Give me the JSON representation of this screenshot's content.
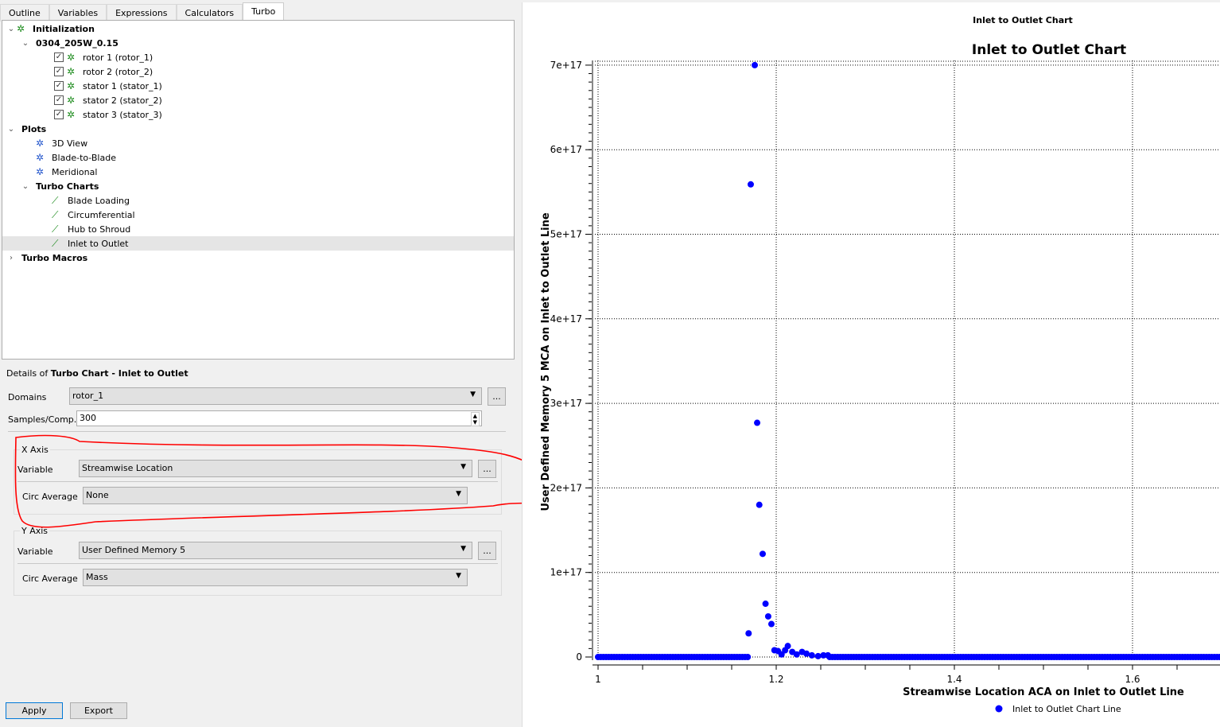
{
  "tabs": [
    "Outline",
    "Variables",
    "Expressions",
    "Calculators",
    "Turbo"
  ],
  "active_tab": "Turbo",
  "tree": {
    "initialization": "Initialization",
    "case": "0304_205W_0.15",
    "components": [
      "rotor 1 (rotor_1)",
      "rotor 2 (rotor_2)",
      "stator 1 (stator_1)",
      "stator 2 (stator_2)",
      "stator 3 (stator_3)"
    ],
    "plots": "Plots",
    "plot_items": [
      "3D View",
      "Blade-to-Blade",
      "Meridional"
    ],
    "turbo_charts": "Turbo Charts",
    "chart_items": [
      "Blade Loading",
      "Circumferential",
      "Hub to Shroud",
      "Inlet to Outlet"
    ],
    "selected": "Inlet to Outlet",
    "turbo_macros": "Turbo Macros"
  },
  "details": {
    "prefix": "Details of ",
    "title": "Turbo Chart - Inlet to Outlet",
    "domains_label": "Domains",
    "domains_value": "rotor_1",
    "samples_label": "Samples/Comp.",
    "samples_value": "300",
    "x_axis": {
      "title": "X Axis",
      "variable_label": "Variable",
      "variable": "Streamwise Location",
      "circ_label": "Circ Average",
      "circ": "None"
    },
    "y_axis": {
      "title": "Y Axis",
      "variable_label": "Variable",
      "variable": "User Defined Memory 5",
      "circ_label": "Circ Average",
      "circ": "Mass"
    },
    "dots": "...",
    "apply": "Apply",
    "export": "Export"
  },
  "annotation_color": "#ff0000",
  "chart_data": {
    "type": "scatter",
    "window_title": "Inlet to Outlet Chart",
    "title": "Inlet to Outlet Chart",
    "xlabel": "Streamwise Location ACA on Inlet to Outlet Line",
    "ylabel": "User Defined Memory 5 MCA on Inlet to Outlet Line",
    "xlim": [
      1.0,
      1.7
    ],
    "ylim": [
      0,
      7e+17
    ],
    "xticks": [
      1,
      1.2,
      1.4,
      1.6
    ],
    "xtick_labels": [
      "1",
      "1.2",
      "1.4",
      "1.6"
    ],
    "yticks": [
      0,
      1e+17,
      2e+17,
      3e+17,
      4e+17,
      5e+17,
      6e+17,
      7e+17
    ],
    "ytick_labels": [
      "0",
      "1e+17",
      "2e+17",
      "3e+17",
      "4e+17",
      "5e+17",
      "6e+17",
      "7e+17"
    ],
    "grid": true,
    "legend": {
      "position": "bottom",
      "label": "Inlet to Outlet Chart Line"
    },
    "color": "#0000ff",
    "baseline_segments": [
      [
        1.0,
        1.168,
        0
      ],
      [
        1.26,
        1.7,
        0
      ]
    ],
    "baseline_step": 0.003,
    "points": [
      [
        1.169,
        2.8e+16
      ],
      [
        1.1714,
        5.59e+17
      ],
      [
        1.1759,
        7e+17
      ],
      [
        1.1786,
        2.77e+17
      ],
      [
        1.181,
        1.8e+17
      ],
      [
        1.1848,
        1.22e+17
      ],
      [
        1.188,
        6.3e+16
      ],
      [
        1.191,
        4.8e+16
      ],
      [
        1.1946,
        3.9e+16
      ],
      [
        1.198,
        8000000000000000.0
      ],
      [
        1.202,
        7000000000000000.0
      ],
      [
        1.206,
        3000000000000000.0
      ],
      [
        1.21,
        8000000000000000.0
      ],
      [
        1.213,
        1.3e+16
      ],
      [
        1.218,
        6000000000000000.0
      ],
      [
        1.223,
        3000000000000000.0
      ],
      [
        1.229,
        6000000000000000.0
      ],
      [
        1.234,
        4000000000000000.0
      ],
      [
        1.24,
        2000000000000000.0
      ],
      [
        1.247,
        1000000000000000.0
      ],
      [
        1.253,
        2000000000000000.0
      ],
      [
        1.258,
        2000000000000000.0
      ]
    ]
  }
}
